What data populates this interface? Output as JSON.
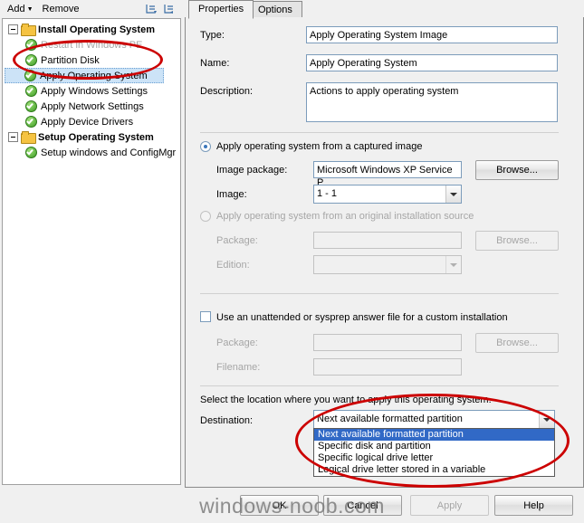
{
  "window": {
    "watermark": "windows-noob.com"
  },
  "left": {
    "toolbar": {
      "add_label": "Add",
      "add_caret": "▼",
      "remove_label": "Remove",
      "icon1_name": "collapse-all-icon",
      "icon2_name": "expand-all-icon"
    },
    "tree": [
      {
        "label": "Install Operating System",
        "type": "folder",
        "bold": true,
        "indent": 0,
        "expander": true
      },
      {
        "label": "Restart in Windows PE",
        "type": "check",
        "bold": false,
        "indent": 1,
        "disabled": true
      },
      {
        "label": "Partition Disk",
        "type": "check",
        "bold": false,
        "indent": 1,
        "disabled": false
      },
      {
        "label": "Apply Operating System",
        "type": "check",
        "bold": false,
        "indent": 1,
        "selected": true
      },
      {
        "label": "Apply Windows Settings",
        "type": "check",
        "bold": false,
        "indent": 1
      },
      {
        "label": "Apply Network Settings",
        "type": "check",
        "bold": false,
        "indent": 1
      },
      {
        "label": "Apply Device Drivers",
        "type": "check",
        "bold": false,
        "indent": 1
      },
      {
        "label": "Setup Operating System",
        "type": "folder",
        "bold": true,
        "indent": 0,
        "expander": true
      },
      {
        "label": "Setup windows and ConfigMgr",
        "type": "check",
        "bold": false,
        "indent": 1
      }
    ]
  },
  "right": {
    "tabs": [
      {
        "label": "Properties",
        "active": true
      },
      {
        "label": "Options",
        "active": false
      }
    ],
    "fields": {
      "type_label": "Type:",
      "type_value": "Apply Operating System Image",
      "name_label": "Name:",
      "name_value": "Apply Operating System",
      "description_label": "Description:",
      "description_value": "Actions to apply operating system"
    },
    "captured": {
      "radio_label": "Apply operating system from a captured image",
      "checked": true,
      "image_package_label": "Image package:",
      "image_package_value": "Microsoft Windows XP Service P",
      "browse_label": "Browse...",
      "image_label": "Image:",
      "image_value": "1 - 1"
    },
    "original": {
      "radio_label": "Apply operating system from an original installation source",
      "checked": false,
      "package_label": "Package:",
      "package_value": "",
      "browse_label": "Browse...",
      "edition_label": "Edition:",
      "edition_value": ""
    },
    "unattend": {
      "checkbox_label": "Use an unattended or sysprep answer file for a custom installation",
      "checked": false,
      "package_label": "Package:",
      "package_value": "",
      "browse_label": "Browse...",
      "filename_label": "Filename:",
      "filename_value": ""
    },
    "destination": {
      "instruction": "Select the location where you want to apply this operating system.",
      "label": "Destination:",
      "value": "Next available formatted partition",
      "options": [
        "Next available formatted partition",
        "Specific disk and partition",
        "Specific logical drive letter",
        "Logical drive letter stored in a variable"
      ],
      "selected_index": 0
    }
  },
  "footer": {
    "ok_label": "OK",
    "cancel_label": "Cancel",
    "apply_label": "Apply",
    "help_label": "Help",
    "apply_disabled": true
  },
  "annotations": {
    "accent_color": "#cc0000",
    "ellipse_partition_disk": "highlight-partition-disk",
    "ellipse_destination": "highlight-destination-dropdown"
  }
}
